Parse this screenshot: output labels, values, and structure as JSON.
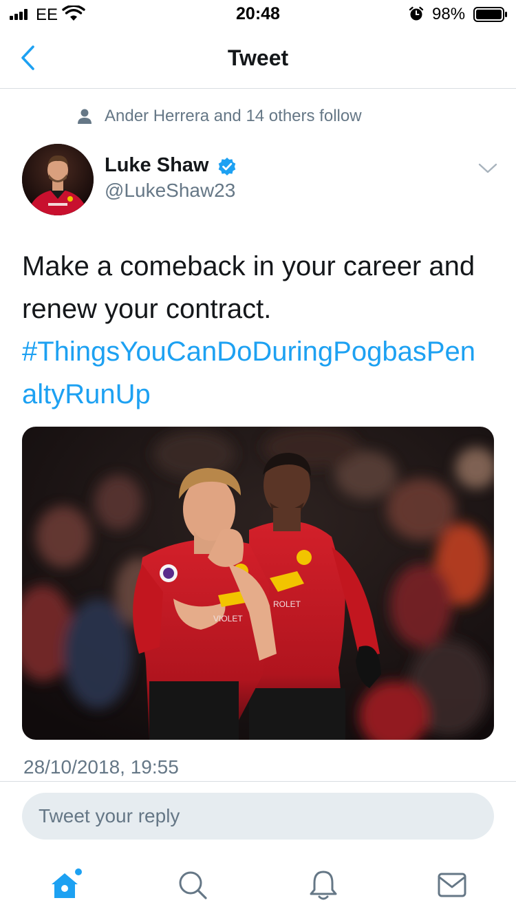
{
  "status_bar": {
    "carrier": "EE",
    "time": "20:48",
    "battery": "98%"
  },
  "nav": {
    "title": "Tweet",
    "back_icon": "chevron-left-icon"
  },
  "tweet": {
    "social_context": "Ander Herrera and 14 others follow",
    "author": {
      "name": "Luke Shaw",
      "handle": "@LukeShaw23",
      "verified": true
    },
    "text": "Make a comeback in your career and renew your contract.",
    "hashtag": "#ThingsYouCanDoDuringPogbasPenaltyRunUp",
    "timestamp": "28/10/2018, 19:55"
  },
  "reply": {
    "placeholder": "Tweet your reply"
  },
  "tab_bar": {
    "items": [
      "home-icon",
      "search-icon",
      "notifications-icon",
      "messages-icon"
    ]
  },
  "colors": {
    "accent": "#1da1f2",
    "secondary_text": "#657786",
    "primary_text": "#14171a",
    "reply_bg": "#e6ecf0"
  }
}
